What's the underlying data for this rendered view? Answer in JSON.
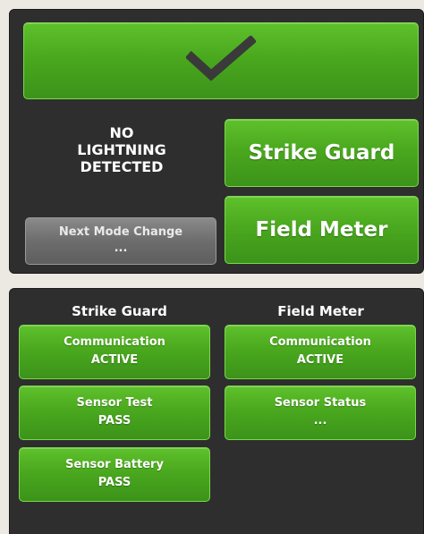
{
  "status_banner": {
    "icon": "checkmark-icon",
    "color": "#4aa81e"
  },
  "alert": {
    "line1": "NO",
    "line2": "LIGHTNING",
    "line3": "DETECTED"
  },
  "buttons": {
    "strike_guard": "Strike Guard",
    "field_meter": "Field Meter"
  },
  "next_mode": {
    "label": "Next Mode Change",
    "value": "..."
  },
  "strike_guard": {
    "header": "Strike Guard",
    "tiles": [
      {
        "label": "Communication",
        "value": "ACTIVE"
      },
      {
        "label": "Sensor Test",
        "value": "PASS"
      },
      {
        "label": "Sensor Battery",
        "value": "PASS"
      }
    ]
  },
  "field_meter": {
    "header": "Field Meter",
    "tiles": [
      {
        "label": "Communication",
        "value": "ACTIVE"
      },
      {
        "label": "Sensor Status",
        "value": "..."
      }
    ]
  },
  "colors": {
    "green": "#4aa81e",
    "panel": "#2e2e2e",
    "gray_button": "#6d6d6d"
  }
}
